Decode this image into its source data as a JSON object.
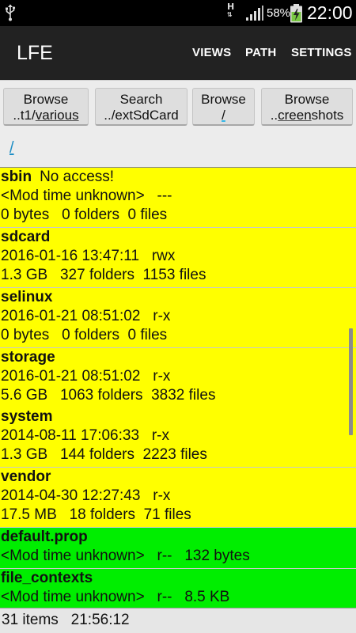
{
  "status_bar": {
    "battery_percent": "58%",
    "time": "22:00",
    "network_type": "H"
  },
  "action_bar": {
    "title": "LFE",
    "menu": [
      "VIEWS",
      "PATH",
      "SETTINGS"
    ]
  },
  "buttons": [
    {
      "top": "Browse",
      "bottom_prefix": "..t1/",
      "bottom_under": "various",
      "bottom_suffix": ""
    },
    {
      "top": "Search",
      "bottom_prefix": "../extSdCard",
      "bottom_under": "",
      "bottom_suffix": ""
    },
    {
      "top": "Browse",
      "bottom_prefix": "",
      "bottom_under": "/",
      "bottom_suffix": ""
    },
    {
      "top": "Browse",
      "bottom_prefix": "..",
      "bottom_under": "creen",
      "bottom_suffix": "shots"
    }
  ],
  "path": "/",
  "rows": [
    {
      "kind": "dir",
      "name": "sbin",
      "note": "No access!",
      "line2": "<Mod time unknown>   ---",
      "line3": "0 bytes   0 folders  0 files"
    },
    {
      "kind": "dir",
      "name": "sdcard",
      "note": "",
      "line2": "2016-01-16 13:47:11   rwx",
      "line3": "1.3 GB   327 folders  1153 files"
    },
    {
      "kind": "dir",
      "name": "selinux",
      "note": "",
      "line2": "2016-01-21 08:51:02   r-x",
      "line3": "0 bytes   0 folders  0 files"
    },
    {
      "kind": "dir",
      "name": "storage",
      "note": "",
      "line2": "2016-01-21 08:51:02   r-x",
      "line3": "5.6 GB   1063 folders  3832 files"
    },
    {
      "kind": "dir",
      "name": "system",
      "note": "",
      "line2": "2014-08-11 17:06:33   r-x",
      "line3": "1.3 GB   144 folders  2223 files"
    },
    {
      "kind": "dir",
      "name": "vendor",
      "note": "",
      "line2": "2014-04-30 12:27:43   r-x",
      "line3": "17.5 MB   18 folders  71 files"
    },
    {
      "kind": "file",
      "name": "default.prop",
      "note": "",
      "line2": "<Mod time unknown>   r--   132 bytes",
      "line3": ""
    },
    {
      "kind": "file",
      "name": "file_contexts",
      "note": "",
      "line2": "<Mod time unknown>   r--   8.5 KB",
      "line3": ""
    }
  ],
  "footer": {
    "item_count": "31 items",
    "time": "21:56:12"
  },
  "colors": {
    "directory_bg": "#ffff00",
    "file_bg": "#00ee00",
    "path_link": "#1e8ec5",
    "action_bar": "#222222"
  }
}
